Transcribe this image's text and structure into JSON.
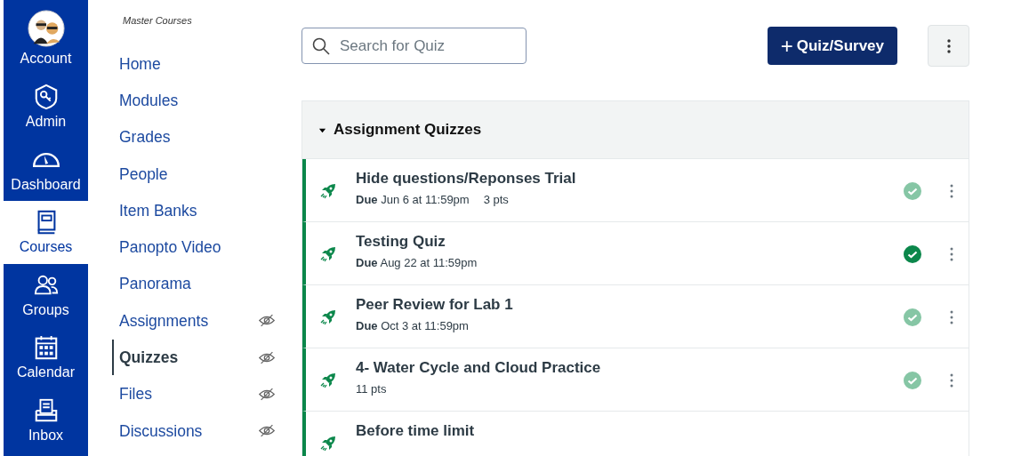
{
  "global_nav": [
    {
      "label": "Account",
      "selected": false
    },
    {
      "label": "Admin",
      "selected": false
    },
    {
      "label": "Dashboard",
      "selected": false
    },
    {
      "label": "Courses",
      "selected": true
    },
    {
      "label": "Groups",
      "selected": false
    },
    {
      "label": "Calendar",
      "selected": false
    },
    {
      "label": "Inbox",
      "selected": false
    }
  ],
  "course_nav": {
    "title": "Master Courses",
    "items": [
      {
        "label": "Home",
        "selected": false,
        "hidden": false
      },
      {
        "label": "Modules",
        "selected": false,
        "hidden": false
      },
      {
        "label": "Grades",
        "selected": false,
        "hidden": false
      },
      {
        "label": "People",
        "selected": false,
        "hidden": false
      },
      {
        "label": "Item Banks",
        "selected": false,
        "hidden": false
      },
      {
        "label": "Panopto Video",
        "selected": false,
        "hidden": false
      },
      {
        "label": "Panorama",
        "selected": false,
        "hidden": false
      },
      {
        "label": "Assignments",
        "selected": false,
        "hidden": true
      },
      {
        "label": "Quizzes",
        "selected": true,
        "hidden": true
      },
      {
        "label": "Files",
        "selected": false,
        "hidden": true
      },
      {
        "label": "Discussions",
        "selected": false,
        "hidden": true
      }
    ]
  },
  "search": {
    "placeholder": "Search for Quiz"
  },
  "add_button": {
    "icon": "+",
    "label": "Quiz/Survey"
  },
  "group": {
    "title": "Assignment Quizzes",
    "expanded": true,
    "quizzes": [
      {
        "title": "Hide questions/Reponses Trial",
        "due_label": "Due",
        "due": "Jun 6 at 11:59pm",
        "points": "3 pts",
        "published": true,
        "hovered": false
      },
      {
        "title": "Testing Quiz",
        "due_label": "Due",
        "due": "Aug 22 at 11:59pm",
        "published": true,
        "hovered": true
      },
      {
        "title": "Peer Review for Lab 1",
        "due_label": "Due",
        "due": "Oct 3 at 11:59pm",
        "published": true,
        "hovered": false
      },
      {
        "title": "4- Water Cycle and Cloud Practice",
        "points": "11 pts",
        "published": true,
        "hovered": false
      },
      {
        "title": "Before time limit"
      }
    ]
  }
}
